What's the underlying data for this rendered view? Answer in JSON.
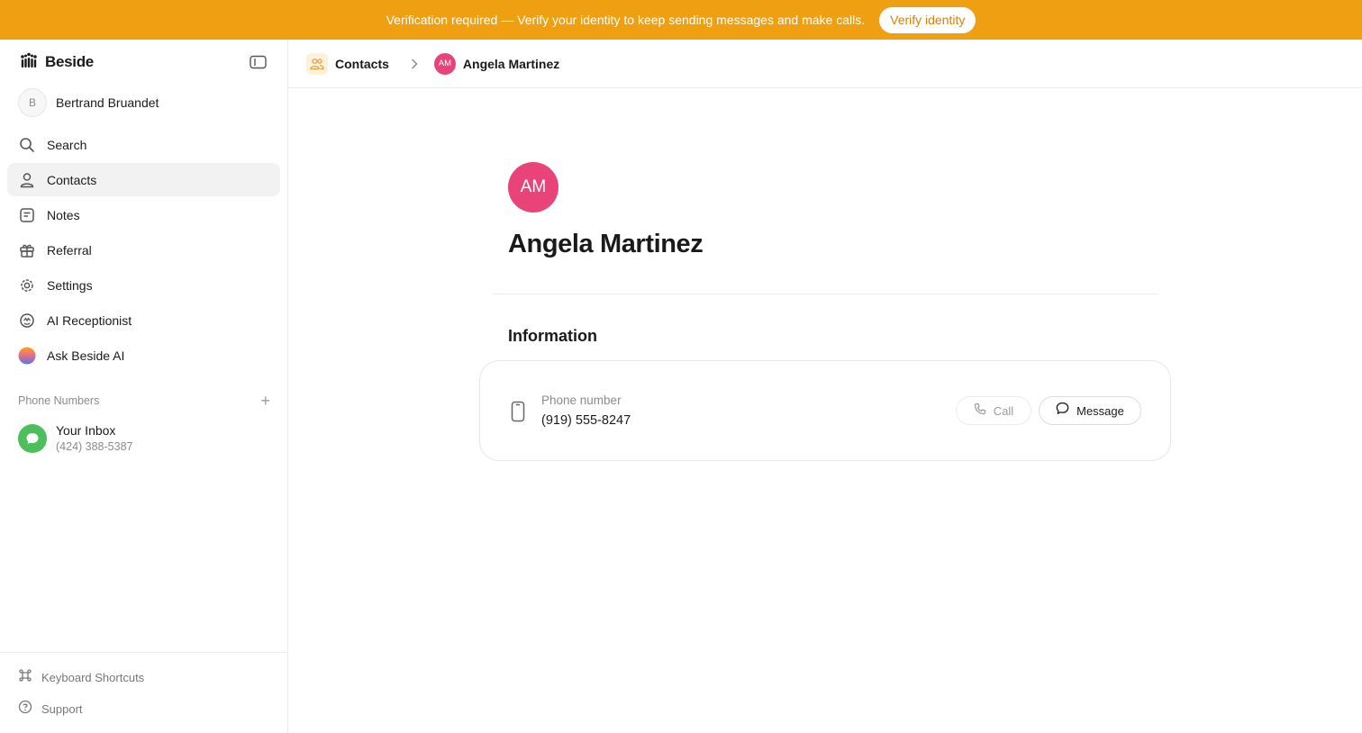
{
  "banner": {
    "text": "Verification required — Verify your identity to keep sending messages and make calls.",
    "button_label": "Verify identity"
  },
  "sidebar": {
    "brand": "Beside",
    "user_initial": "B",
    "user_name": "Bertrand Bruandet",
    "items": [
      {
        "label": "Search",
        "icon": "search-icon"
      },
      {
        "label": "Contacts",
        "icon": "person-icon",
        "active": true
      },
      {
        "label": "Notes",
        "icon": "note-icon"
      },
      {
        "label": "Referral",
        "icon": "gift-icon"
      },
      {
        "label": "Settings",
        "icon": "gear-icon"
      },
      {
        "label": "AI Receptionist",
        "icon": "ai-receptionist-icon"
      },
      {
        "label": "Ask Beside AI",
        "icon": "gradient-orb-icon"
      }
    ],
    "phone_numbers_title": "Phone Numbers",
    "inbox": {
      "title": "Your Inbox",
      "number": "(424) 388-5387"
    },
    "footer": [
      {
        "label": "Keyboard Shortcuts",
        "icon": "command-icon"
      },
      {
        "label": "Support",
        "icon": "help-icon"
      }
    ]
  },
  "breadcrumb": {
    "section": "Contacts",
    "contact_initials": "AM",
    "contact_name": "Angela Martinez"
  },
  "contact": {
    "initials": "AM",
    "name": "Angela Martinez",
    "avatar_color": "#e8447a",
    "information_title": "Information",
    "phone_label": "Phone number",
    "phone_value": "(919) 555-8247",
    "call_label": "Call",
    "message_label": "Message"
  },
  "colors": {
    "banner": "#ef9f12",
    "inbox_avatar": "#4cbe5c"
  }
}
